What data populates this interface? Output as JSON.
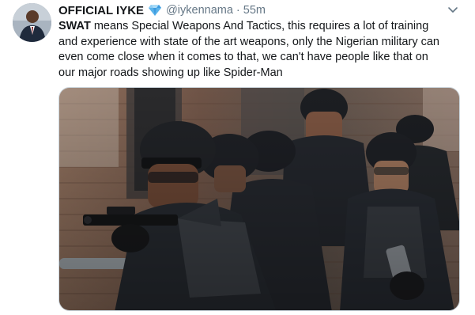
{
  "tweet": {
    "display_name": "OFFICIAL IYKE",
    "verified_icon": "blue-diamond-emoji",
    "handle": "@iykennama",
    "separator": "·",
    "time": "55m",
    "text_lines": [
      {
        "bold": "SWAT",
        "rest": " means Special Weapons And Tactics, this requires  a lot of training"
      },
      {
        "bold": "",
        "rest": "and experience with state of the art weapons, only the Nigerian military can"
      },
      {
        "bold": "",
        "rest": "even come close when it comes to that, we can't have people like that on"
      },
      {
        "bold": "",
        "rest": "our major roads  showing up like Spider-Man"
      }
    ],
    "media": {
      "icon": "photo-swat-team-with-rifles"
    }
  },
  "colors": {
    "name": "#14171a",
    "meta": "#657786",
    "border": "#ccd6dd",
    "diamond": "#1da1f2"
  }
}
